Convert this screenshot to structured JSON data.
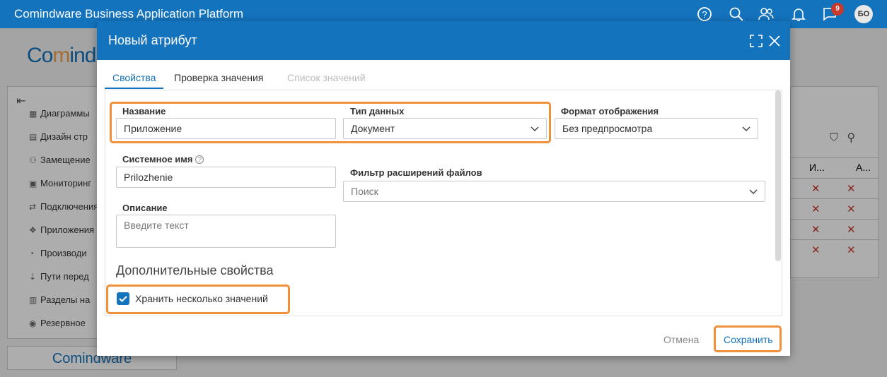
{
  "app": {
    "title": "Comindware Business Application Platform",
    "notification_count": "9",
    "user_initials": "БО"
  },
  "background": {
    "logo_prefix": "Co",
    "logo_highlight": "m",
    "logo_rest": "ind",
    "footer_logo": "Comindware",
    "sidebar_items": [
      {
        "label": "Диаграммы",
        "icon": "diagram-icon"
      },
      {
        "label": "Дизайн стр",
        "icon": "design-icon"
      },
      {
        "label": "Замещение",
        "icon": "substitution-icon"
      },
      {
        "label": "Мониторинг",
        "icon": "monitor-icon"
      },
      {
        "label": "Подключения",
        "icon": "connection-icon"
      },
      {
        "label": "Приложения",
        "icon": "apps-icon"
      },
      {
        "label": "Производи",
        "icon": "performance-icon"
      },
      {
        "label": "Пути перед",
        "icon": "path-icon"
      },
      {
        "label": "Разделы на",
        "icon": "sections-icon"
      },
      {
        "label": "Резервное",
        "icon": "backup-icon"
      }
    ],
    "table_headers": [
      "И...",
      "А..."
    ]
  },
  "modal": {
    "title": "Новый атрибут",
    "tabs": [
      {
        "label": "Свойства",
        "state": "active"
      },
      {
        "label": "Проверка значения",
        "state": "normal"
      },
      {
        "label": "Список значений",
        "state": "disabled"
      }
    ],
    "name_label": "Название",
    "name_value": "Приложение",
    "datatype_label": "Тип данных",
    "datatype_value": "Документ",
    "format_label": "Формат отображения",
    "format_value": "Без предпросмотра",
    "sysname_label": "Системное имя",
    "sysname_value": "Prilozhenie",
    "filter_label": "Фильтр расширений файлов",
    "filter_placeholder": "Поиск",
    "desc_label": "Описание",
    "desc_placeholder": "Введите текст",
    "section_title": "Дополнительные свойства",
    "multi_label": "Хранить несколько значений",
    "multi_checked": true,
    "cancel_label": "Отмена",
    "save_label": "Сохранить"
  },
  "colors": {
    "brand": "#1473bd",
    "highlight": "#f0903a",
    "error": "#c8382c"
  }
}
